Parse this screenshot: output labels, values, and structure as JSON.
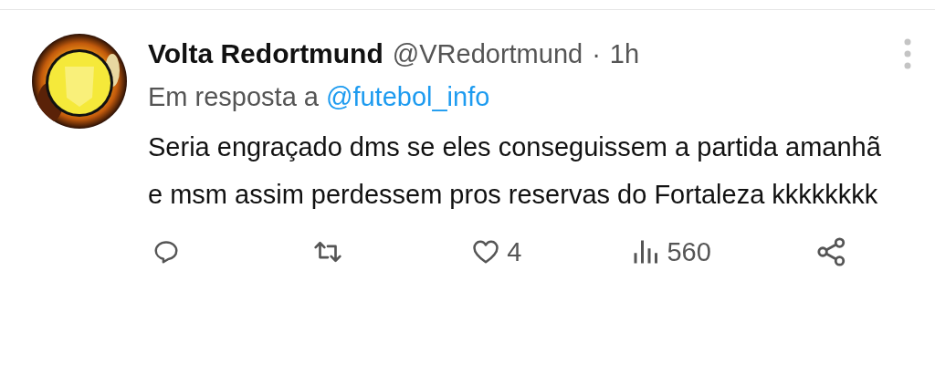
{
  "tweet": {
    "name": "Volta Redortmund",
    "handle": "@VRedortmund",
    "separator": "·",
    "time": "1h",
    "reply_prefix": "Em resposta a",
    "reply_to": "@futebol_info",
    "text": "Seria engraçado dms se eles conseguissem a partida amanhã e msm assim perdessem pros reservas do Fortaleza kkkkkkkk"
  },
  "actions": [
    {
      "kind": "reply"
    },
    {
      "kind": "retweet"
    },
    {
      "kind": "like",
      "count": "4"
    },
    {
      "kind": "views",
      "count": "560"
    },
    {
      "kind": "share"
    }
  ]
}
